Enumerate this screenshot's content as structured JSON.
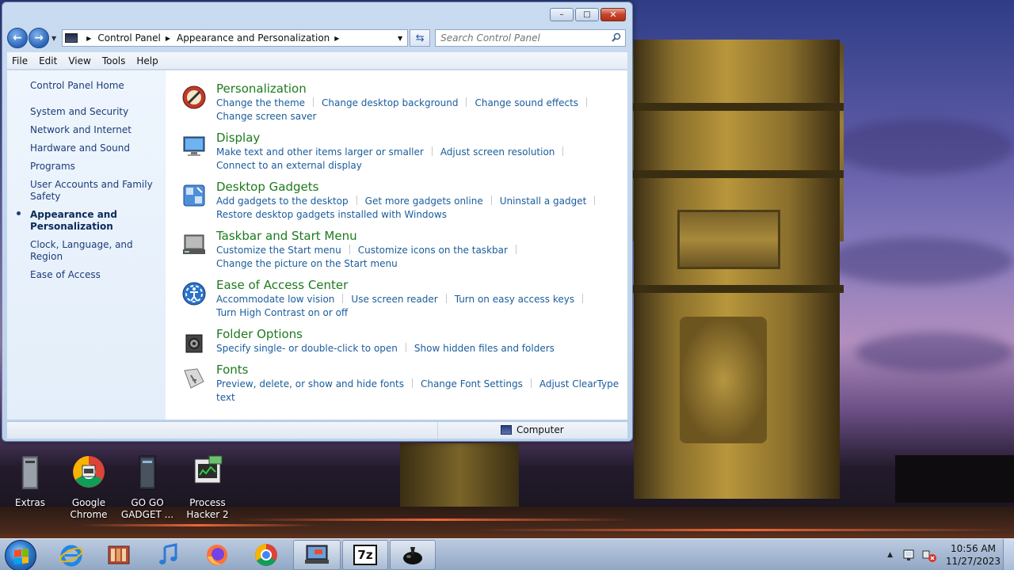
{
  "window": {
    "controls": {
      "minimize": "–",
      "maximize": "□",
      "close": "✕"
    }
  },
  "navbar": {
    "back_glyph": "←",
    "forward_glyph": "→",
    "breadcrumb": [
      "Control Panel",
      "Appearance and Personalization"
    ],
    "search_placeholder": "Search Control Panel"
  },
  "menubar": [
    "File",
    "Edit",
    "View",
    "Tools",
    "Help"
  ],
  "sidebar": {
    "home": "Control Panel Home",
    "items": [
      "System and Security",
      "Network and Internet",
      "Hardware and Sound",
      "Programs",
      "User Accounts and Family Safety",
      "Appearance and Personalization",
      "Clock, Language, and Region",
      "Ease of Access"
    ],
    "active": "Appearance and Personalization"
  },
  "categories": [
    {
      "title": "Personalization",
      "icon": "personalization-icon",
      "links": [
        "Change the theme",
        "Change desktop background",
        "Change sound effects",
        "Change screen saver"
      ]
    },
    {
      "title": "Display",
      "icon": "display-icon",
      "links": [
        "Make text and other items larger or smaller",
        "Adjust screen resolution",
        "Connect to an external display"
      ]
    },
    {
      "title": "Desktop Gadgets",
      "icon": "gadgets-icon",
      "links": [
        "Add gadgets to the desktop",
        "Get more gadgets online",
        "Uninstall a gadget",
        "Restore desktop gadgets installed with Windows"
      ]
    },
    {
      "title": "Taskbar and Start Menu",
      "icon": "taskbar-icon",
      "links": [
        "Customize the Start menu",
        "Customize icons on the taskbar",
        "Change the picture on the Start menu"
      ]
    },
    {
      "title": "Ease of Access Center",
      "icon": "ease-of-access-icon",
      "links": [
        "Accommodate low vision",
        "Use screen reader",
        "Turn on easy access keys",
        "Turn High Contrast on or off"
      ]
    },
    {
      "title": "Folder Options",
      "icon": "folder-options-icon",
      "links": [
        "Specify single- or double-click to open",
        "Show hidden files and folders"
      ]
    },
    {
      "title": "Fonts",
      "icon": "fonts-icon",
      "links": [
        "Preview, delete, or show and hide fonts",
        "Change Font Settings",
        "Adjust ClearType text"
      ]
    }
  ],
  "statusbar": {
    "location": "Computer"
  },
  "desktop_icons": [
    {
      "label": "Extras"
    },
    {
      "label": "Google Chrome"
    },
    {
      "label": "GO GO GADGET ..."
    },
    {
      "label": "Process Hacker 2"
    }
  ],
  "taskbar": {
    "pinned": [
      "internet-explorer-icon",
      "media-library-icon",
      "itunes-icon",
      "firefox-icon",
      "chrome-icon",
      "control-panel-icon",
      "7zip-icon",
      "gadget-icon"
    ],
    "clock_time": "10:56 AM",
    "clock_date": "11/27/2023",
    "seven_zip_label": "7z"
  },
  "colors": {
    "category_title": "#1e7a1e",
    "link": "#1a5c9c",
    "sidebar_link": "#1c3c78"
  }
}
